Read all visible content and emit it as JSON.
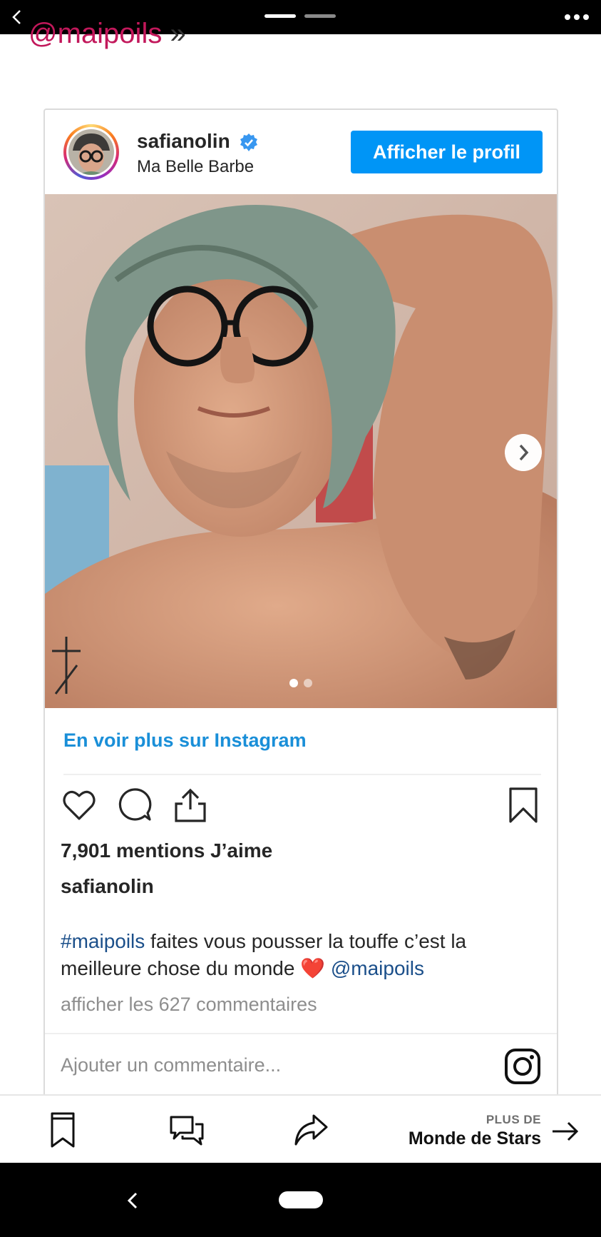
{
  "article": {
    "snippet_handle": "@maipoils",
    "snippet_quote": "»"
  },
  "post": {
    "username": "safianolin",
    "subtitle": "Ma Belle Barbe",
    "profile_button": "Afficher le profil",
    "see_more": "En voir plus sur Instagram",
    "likes": "7,901 mentions J’aime",
    "caption_user": "safianolin",
    "caption": {
      "hashtag": "#maipoils",
      "text": " faites vous pousser la touffe c’est la meilleure chose du monde ",
      "heart": "❤️",
      "mention": "@maipoils"
    },
    "comments_link": "afficher les 627 commentaires",
    "add_comment_placeholder": "Ajouter un commentaire...",
    "carousel": {
      "current": 1,
      "total": 2
    }
  },
  "bottom_bar": {
    "next_small": "PLUS DE",
    "next_label": "Monde de Stars"
  },
  "icons": {
    "top_back": "chevron-left-icon",
    "more": "more-horizontal-icon",
    "verified": "verified-badge-icon",
    "like": "heart-outline-icon",
    "comment": "comment-bubble-icon",
    "share": "share-upload-icon",
    "bookmark": "bookmark-icon",
    "instagram": "instagram-logo-icon",
    "bb_bookmark": "bookmark-icon",
    "bb_comments": "comments-icon",
    "bb_share": "share-arrow-icon",
    "next_arrow": "arrow-right-icon"
  },
  "colors": {
    "accent_blue": "#0095f6",
    "link_blue": "#1a8fd8",
    "tag_blue": "#1b4f8a",
    "handle_pink": "#c2185b"
  }
}
